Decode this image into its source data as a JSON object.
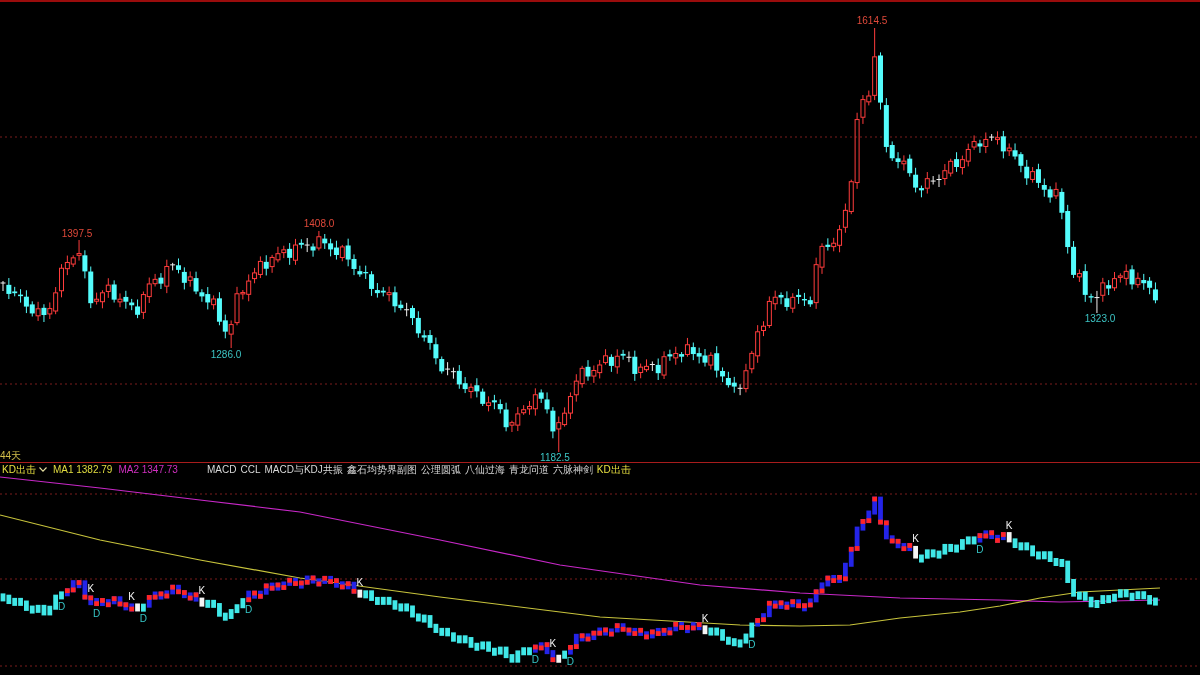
{
  "main_chart": {
    "price_labels": [
      {
        "kind": "high",
        "text": "1397.5"
      },
      {
        "kind": "low",
        "text": "1286.0"
      },
      {
        "kind": "high",
        "text": "1408.0"
      },
      {
        "kind": "low",
        "text": "1182.5"
      },
      {
        "kind": "high",
        "text": "1614.5"
      },
      {
        "kind": "low",
        "text": "1323.0"
      }
    ],
    "period_label": "44天"
  },
  "indicator_bar": {
    "selector": "KD出击",
    "ma1": "MA1 1382.79",
    "ma2": "MA2 1347.73",
    "tabs": [
      {
        "label": "MACD",
        "selected": false
      },
      {
        "label": "CCL",
        "selected": false
      },
      {
        "label": "MACD与KDJ共振",
        "selected": false
      },
      {
        "label": "鑫石均势界副图",
        "selected": false
      },
      {
        "label": "公理圆弧",
        "selected": false
      },
      {
        "label": "八仙过海",
        "selected": false
      },
      {
        "label": "青龙问道",
        "selected": false
      },
      {
        "label": "六脉神剑",
        "selected": false
      },
      {
        "label": "KD出击",
        "selected": true
      }
    ]
  },
  "kd_panel": {
    "signals": [
      {
        "kind": "D",
        "text": "D"
      },
      {
        "kind": "K",
        "text": "K"
      },
      {
        "kind": "D",
        "text": "D"
      },
      {
        "kind": "K",
        "text": "K"
      },
      {
        "kind": "D",
        "text": "D"
      },
      {
        "kind": "K",
        "text": "K"
      },
      {
        "kind": "D",
        "text": "D"
      },
      {
        "kind": "K",
        "text": "K"
      },
      {
        "kind": "D",
        "text": "D"
      },
      {
        "kind": "K",
        "text": "K"
      },
      {
        "kind": "D",
        "text": "D"
      },
      {
        "kind": "K",
        "text": "K"
      },
      {
        "kind": "D",
        "text": "D"
      },
      {
        "kind": "K",
        "text": "K"
      },
      {
        "kind": "D",
        "text": "D"
      },
      {
        "kind": "K",
        "text": "K"
      }
    ]
  }
}
